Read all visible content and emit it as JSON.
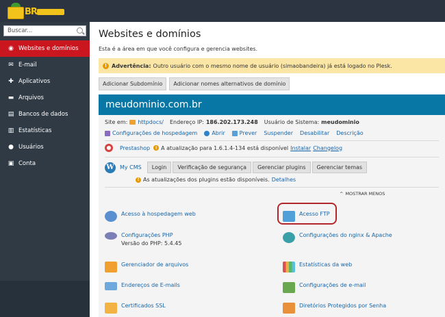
{
  "brand": {
    "logo_text": "BR"
  },
  "search": {
    "placeholder": "Buscar..."
  },
  "sidebar": {
    "items": [
      {
        "label": "Websites e domínios",
        "icon": "globe-icon"
      },
      {
        "label": "E-mail",
        "icon": "envelope-icon"
      },
      {
        "label": "Aplicativos",
        "icon": "puzzle-icon"
      },
      {
        "label": "Arquivos",
        "icon": "folder-icon"
      },
      {
        "label": "Bancos de dados",
        "icon": "database-icon"
      },
      {
        "label": "Estatísticas",
        "icon": "bar-chart-icon"
      },
      {
        "label": "Usuários",
        "icon": "user-icon"
      },
      {
        "label": "Conta",
        "icon": "id-card-icon"
      }
    ]
  },
  "page": {
    "title": "Websites e domínios",
    "description": "Esta é a área em que você configura e gerencia websites."
  },
  "alert": {
    "label": "Advertência:",
    "text": "Outro usuário com o mesmo nome de usuário (simaobandeira) já está logado no Plesk."
  },
  "buttons": {
    "add_subdomain": "Adicionar Subdomínio",
    "add_aliases": "Adicionar nomes alternativos de domínio"
  },
  "domain": {
    "name": "meudominio.com.br",
    "site_label": "Site em:",
    "site_folder": "httpdocs/",
    "ip_label": "Endereço IP:",
    "ip": "186.202.173.248",
    "sysuser_label": "Usuário de Sistema:",
    "sysuser": "meudominio",
    "actions": [
      "Configurações de hospedagem",
      "Abrir",
      "Prever",
      "Suspender",
      "Desabilitar",
      "Descrição"
    ]
  },
  "prestashop": {
    "name": "Prestashop",
    "update_text": "A atualização para 1.6.1.4-134 está disponível",
    "install": "Instalar",
    "changelog": "Changelog"
  },
  "mycms": {
    "name": "My CMS",
    "tabs": [
      "Login",
      "Verificação de segurança",
      "Gerenciar plugins",
      "Gerenciar temas"
    ],
    "plugin_note": "As atualizações dos plugins estão disponíveis.",
    "details": "Detalhes"
  },
  "show_less": "MOSTRAR MENOS",
  "tools": {
    "hosting_access": "Acesso à hospedagem web",
    "ftp_access": "Acesso FTP",
    "php_settings": "Configurações PHP",
    "php_version": "Versão do PHP: 5.4.45",
    "nginx_apache": "Configurações do nginx & Apache",
    "file_manager": "Gerenciador de arquivos",
    "web_stats": "Estatísticas da web",
    "email_addresses": "Endereços de E-mails",
    "email_settings": "Configurações de e-mail",
    "ssl": "Certificados SSL",
    "protected_dirs": "Diretórios Protegidos por Senha"
  }
}
